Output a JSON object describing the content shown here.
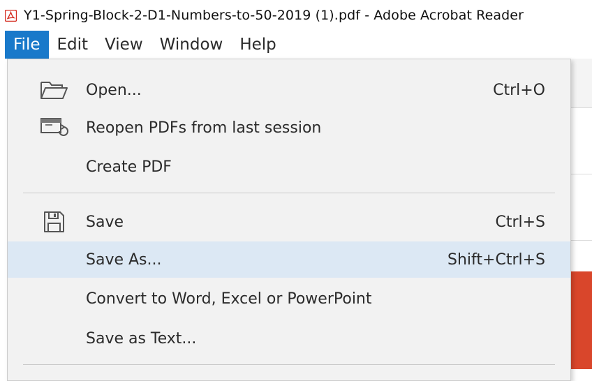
{
  "window": {
    "title": "Y1-Spring-Block-2-D1-Numbers-to-50-2019 (1).pdf - Adobe Acrobat Reader"
  },
  "menubar": {
    "items": [
      {
        "label": "File",
        "active": true
      },
      {
        "label": "Edit"
      },
      {
        "label": "View"
      },
      {
        "label": "Window"
      },
      {
        "label": "Help"
      }
    ]
  },
  "file_menu": {
    "items": [
      {
        "label": "Open...",
        "shortcut": "Ctrl+O",
        "icon": "folder-open-icon"
      },
      {
        "label": "Reopen PDFs from last session",
        "shortcut": "",
        "icon": "reopen-session-icon"
      },
      {
        "label": "Create PDF",
        "shortcut": ""
      },
      {
        "label": "Save",
        "shortcut": "Ctrl+S",
        "icon": "save-floppy-icon"
      },
      {
        "label": "Save As...",
        "shortcut": "Shift+Ctrl+S",
        "highlighted": true
      },
      {
        "label": "Convert to Word, Excel or PowerPoint",
        "shortcut": ""
      },
      {
        "label": "Save as Text...",
        "shortcut": ""
      }
    ]
  },
  "colors": {
    "menu_active": "#1979ca",
    "menu_background": "#f2f2f2",
    "highlight": "#dce8f4",
    "accent_red": "#d9462b"
  }
}
